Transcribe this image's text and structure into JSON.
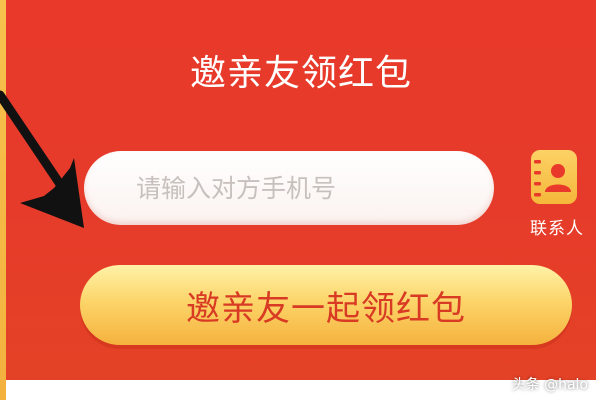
{
  "theme": {
    "panel_color": "#e63b2a",
    "button_color": "#fcd56a",
    "button_text_color": "#d83a24",
    "contact_icon_color": "#f4b73a"
  },
  "panel": {
    "title": "邀亲友领红包"
  },
  "phone_input": {
    "placeholder": "请输入对方手机号",
    "value": ""
  },
  "contacts": {
    "icon": "contact-book-icon",
    "label": "联系人"
  },
  "invite_button": {
    "label": "邀亲友一起领红包"
  },
  "annotation": {
    "icon": "pointer-arrow"
  },
  "watermark": {
    "text": "头条 @halo"
  }
}
